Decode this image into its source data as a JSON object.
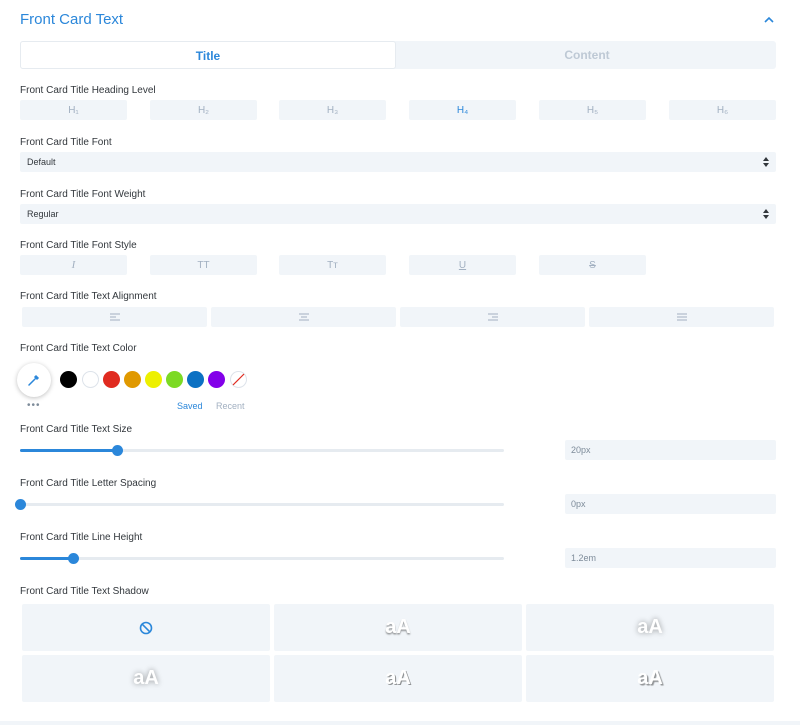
{
  "section": {
    "title": "Front Card Text"
  },
  "tabs": {
    "title": "Title",
    "content": "Content"
  },
  "heading_level": {
    "label": "Front Card Title Heading Level",
    "options": [
      "H₁",
      "H₂",
      "H₃",
      "H₄",
      "H₅",
      "H₆"
    ],
    "selected": "H₄"
  },
  "font": {
    "label": "Front Card Title Font",
    "value": "Default"
  },
  "font_weight": {
    "label": "Front Card Title Font Weight",
    "value": "Regular"
  },
  "font_style": {
    "label": "Front Card Title Font Style",
    "buttons": [
      "I",
      "TT",
      "Tт",
      "U",
      "S"
    ]
  },
  "alignment": {
    "label": "Front Card Title Text Alignment"
  },
  "text_color": {
    "label": "Front Card Title Text Color",
    "swatches": [
      "#000000",
      "#ffffff",
      "#e02b20",
      "#e09900",
      "#edf000",
      "#7cda24",
      "#0c71c3",
      "#8300e9"
    ],
    "more": "•••",
    "saved": "Saved",
    "recent": "Recent"
  },
  "text_size": {
    "label": "Front Card Title Text Size",
    "value": "20px",
    "fraction": 0.2
  },
  "letter_spacing": {
    "label": "Front Card Title Letter Spacing",
    "value": "0px",
    "fraction": 0.0
  },
  "line_height": {
    "label": "Front Card Title Line Height",
    "value": "1.2em",
    "fraction": 0.11
  },
  "text_shadow": {
    "label": "Front Card Title Text Shadow",
    "preview_text": "aA"
  },
  "colors": {
    "accent": "#2b87da",
    "panel": "#f1f5f9",
    "muted": "#a2b0c1"
  }
}
